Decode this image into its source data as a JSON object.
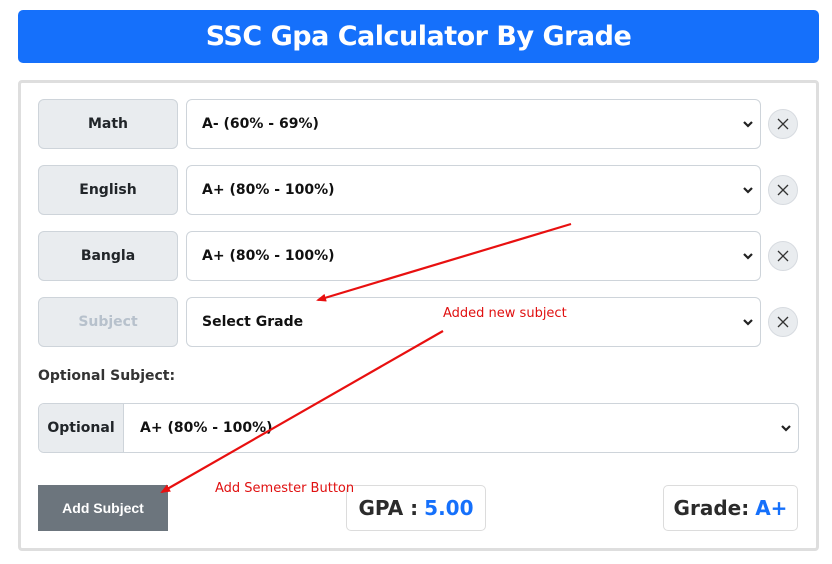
{
  "header": {
    "title": "SSC Gpa Calculator By Grade"
  },
  "subjects": [
    {
      "name": "Math",
      "grade": "A- (60% - 69%)",
      "is_placeholder": false
    },
    {
      "name": "English",
      "grade": "A+ (80% - 100%)",
      "is_placeholder": false
    },
    {
      "name": "Bangla",
      "grade": "A+ (80% - 100%)",
      "is_placeholder": false
    },
    {
      "name": "Subject",
      "grade": "Select Grade",
      "is_placeholder": true
    }
  ],
  "optional": {
    "heading": "Optional Subject:",
    "addon_label": "Optional",
    "grade": "A+ (80% - 100%)"
  },
  "actions": {
    "add_subject_label": "Add Subject"
  },
  "result": {
    "gpa_label": "GPA :",
    "gpa_value": "5.00",
    "grade_label": "Grade:",
    "grade_value": "A+"
  },
  "annotations": {
    "added_new_subject": "Added new subject",
    "add_semester_button": "Add Semester Button"
  },
  "icons": {
    "remove": "close-icon",
    "dropdown": "chevron-down-icon"
  },
  "colors": {
    "primary": "#1570fb",
    "secondary_button": "#6c757d",
    "annotation": "#e01010"
  }
}
